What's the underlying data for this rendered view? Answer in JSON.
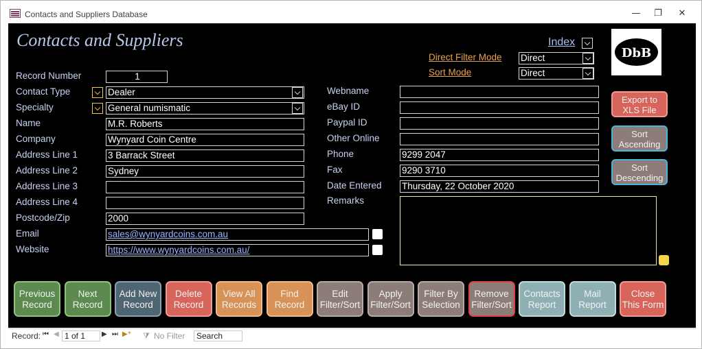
{
  "window": {
    "title": "Contacts and Suppliers Database",
    "minimize": "—",
    "restore": "❐",
    "close": "✕"
  },
  "form": {
    "title": "Contacts and Suppliers",
    "index_link": "Index",
    "direct_filter_mode_label": "Direct Filter Mode",
    "direct_filter_mode_value": "Direct",
    "sort_mode_label": "Sort Mode",
    "sort_mode_value": "Direct",
    "logo_text": "DbB"
  },
  "fields_left": [
    {
      "label": "Record Number",
      "value": "1"
    },
    {
      "label": "Contact Type",
      "value": "Dealer"
    },
    {
      "label": "Specialty",
      "value": "General numismatic"
    },
    {
      "label": "Name",
      "value": "M.R. Roberts"
    },
    {
      "label": "Company",
      "value": "Wynyard Coin Centre"
    },
    {
      "label": "Address Line 1",
      "value": "3 Barrack Street"
    },
    {
      "label": "Address Line 2",
      "value": "Sydney"
    },
    {
      "label": "Address Line 3",
      "value": ""
    },
    {
      "label": "Address Line 4",
      "value": ""
    },
    {
      "label": "Postcode/Zip",
      "value": "2000"
    },
    {
      "label": "Email",
      "value": "sales@wynyardcoins.com.au"
    },
    {
      "label": "Website",
      "value": "https://www.wynyardcoins.com.au/"
    }
  ],
  "fields_right": [
    {
      "label": "Webname",
      "value": ""
    },
    {
      "label": "eBay ID",
      "value": ""
    },
    {
      "label": "Paypal ID",
      "value": ""
    },
    {
      "label": "Other Online",
      "value": ""
    },
    {
      "label": "Phone",
      "value": "9299 2047"
    },
    {
      "label": "Fax",
      "value": "9290 3710"
    },
    {
      "label": "Date Entered",
      "value": "Thursday, 22 October 2020"
    },
    {
      "label": "Remarks",
      "value": ""
    }
  ],
  "side_buttons": {
    "export": [
      "Export to",
      "XLS File"
    ],
    "sort_asc": [
      "Sort",
      "Ascending"
    ],
    "sort_desc": [
      "Sort",
      "Descending"
    ]
  },
  "bottom_buttons": [
    {
      "l1": "Previous",
      "l2": "Record",
      "bg": "#5c8a4f",
      "bd": "#8fc47f"
    },
    {
      "l1": "Next",
      "l2": "Record",
      "bg": "#5c8a4f",
      "bd": "#8fc47f"
    },
    {
      "l1": "Add New",
      "l2": "Record",
      "bg": "#4f6571",
      "bd": "#8aa3b2"
    },
    {
      "l1": "Delete",
      "l2": "Record",
      "bg": "#d7655c",
      "bd": "#f29a93"
    },
    {
      "l1": "View All",
      "l2": "Records",
      "bg": "#d79357",
      "bd": "#f2bb86"
    },
    {
      "l1": "Find",
      "l2": "Record",
      "bg": "#d79357",
      "bd": "#f2bb86"
    },
    {
      "l1": "Edit",
      "l2": "Filter/Sort",
      "bg": "#8d7d79",
      "bd": "#b7aaa7"
    },
    {
      "l1": "Apply",
      "l2": "Filter/Sort",
      "bg": "#8d7d79",
      "bd": "#b7aaa7"
    },
    {
      "l1": "Filter By",
      "l2": "Selection",
      "bg": "#8d7d79",
      "bd": "#b7aaa7"
    },
    {
      "l1": "Remove",
      "l2": "Filter/Sort",
      "bg": "#8d7d79",
      "bd": "#e0413a"
    },
    {
      "l1": "Contacts",
      "l2": "Report",
      "bg": "#8fb0b3",
      "bd": "#c1d9db"
    },
    {
      "l1": "Mail",
      "l2": "Report",
      "bg": "#8fb0b3",
      "bd": "#c1d9db"
    },
    {
      "l1": "Close",
      "l2": "This Form",
      "bg": "#d7655c",
      "bd": "#f29a93"
    }
  ],
  "status_bar": {
    "record_label": "Record:",
    "first_glyph": "⏮",
    "prev_glyph": "◀",
    "position": "1 of 1",
    "next_glyph": "▶",
    "last_glyph": "⏭",
    "new_glyph": "▶*",
    "filter_icon": "funnel-icon",
    "filter_text": "No Filter",
    "search_text": "Search"
  }
}
